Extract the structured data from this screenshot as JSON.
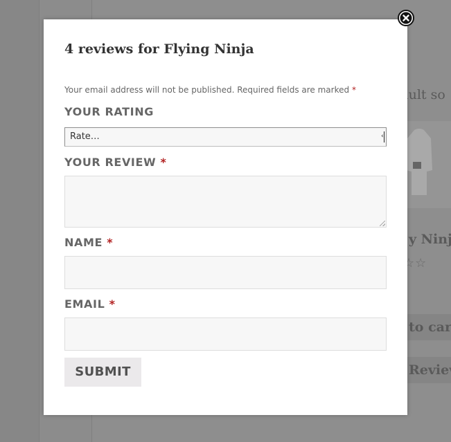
{
  "background": {
    "sort_text": "efault so",
    "product_title": "y Ninja",
    "stars": "☆☆",
    "add_to_cart_label": "to cart",
    "reviews_label": "Review"
  },
  "modal": {
    "title": "4 reviews for Flying Ninja",
    "notice": "Your email address will not be published. Required fields are marked",
    "required_mark": "*",
    "rating": {
      "label": "YOUR RATING",
      "selected": "Rate…"
    },
    "review": {
      "label": "YOUR REVIEW",
      "value": ""
    },
    "name": {
      "label": "NAME",
      "value": ""
    },
    "email": {
      "label": "EMAIL",
      "value": ""
    },
    "submit_label": "SUBMIT"
  },
  "colors": {
    "overlay": "#8e8e8e",
    "required": "#b22222",
    "field_bg": "#f7f7f7",
    "button_bg": "#ebe9eb"
  },
  "icons": {
    "close": "close-icon",
    "select_arrow": "chevron-down-icon",
    "resize": "resize-grip-icon"
  }
}
